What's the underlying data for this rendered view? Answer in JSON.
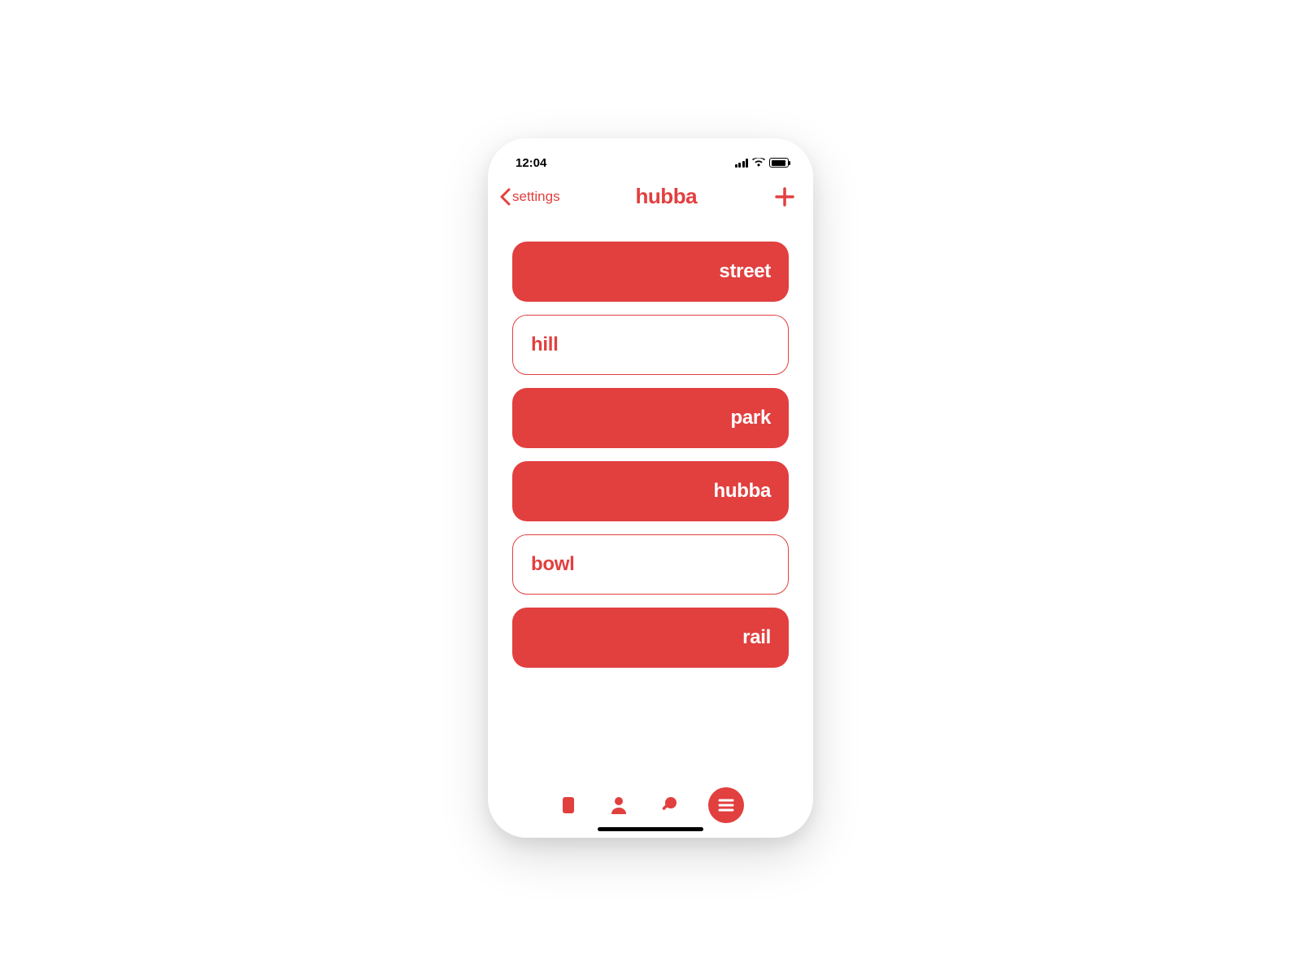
{
  "statusBar": {
    "time": "12:04"
  },
  "header": {
    "backLabel": "settings",
    "title": "hubba"
  },
  "list": [
    {
      "label": "street",
      "style": "filled"
    },
    {
      "label": "hill",
      "style": "outline"
    },
    {
      "label": "park",
      "style": "filled"
    },
    {
      "label": "hubba",
      "style": "filled"
    },
    {
      "label": "bowl",
      "style": "outline"
    },
    {
      "label": "rail",
      "style": "filled"
    }
  ],
  "colors": {
    "accent": "#e23f3f"
  }
}
